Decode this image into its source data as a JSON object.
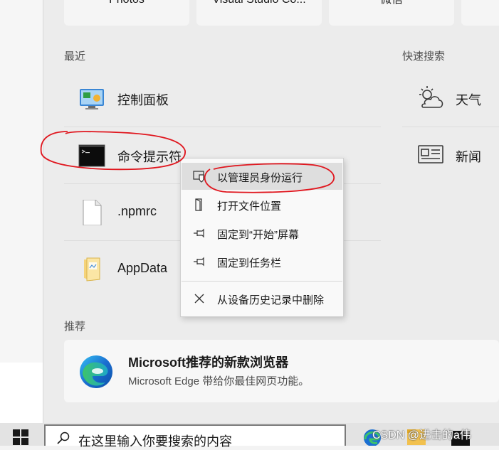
{
  "pinned_tiles": [
    "Photos",
    "Visual Studio Co...",
    "微信",
    ""
  ],
  "recent": {
    "title": "最近",
    "items": [
      {
        "label": "控制面板",
        "icon": "control-panel-icon"
      },
      {
        "label": "命令提示符",
        "icon": "command-prompt-icon"
      },
      {
        "label": ".npmrc",
        "icon": "file-icon"
      },
      {
        "label": "AppData",
        "icon": "folder-icon"
      }
    ]
  },
  "quick_search": {
    "title": "快速搜索",
    "items": [
      {
        "label": "天气",
        "icon": "weather-icon"
      },
      {
        "label": "新闻",
        "icon": "news-icon"
      }
    ]
  },
  "context_menu": {
    "items": [
      {
        "label": "以管理员身份运行",
        "icon": "shield-admin-icon",
        "highlighted": true
      },
      {
        "label": "打开文件位置",
        "icon": "open-folder-icon"
      },
      {
        "label": "固定到“开始”屏幕",
        "icon": "pin-icon"
      },
      {
        "label": "固定到任务栏",
        "icon": "pin-icon"
      },
      {
        "label": "从设备历史记录中删除",
        "icon": "close-icon"
      }
    ]
  },
  "recommended": {
    "title": "推荐",
    "card": {
      "title": "Microsoft推荐的新款浏览器",
      "subtitle": "Microsoft Edge 带给你最佳网页功能。",
      "icon": "edge-icon"
    }
  },
  "taskbar": {
    "search_placeholder": "在这里输入你要搜索的内容",
    "watermark": "CSDN @进击的a伟"
  },
  "colors": {
    "annotation_red": "#e0161e",
    "edge_blue": "#1b6fd1",
    "edge_green": "#3cc46a"
  }
}
